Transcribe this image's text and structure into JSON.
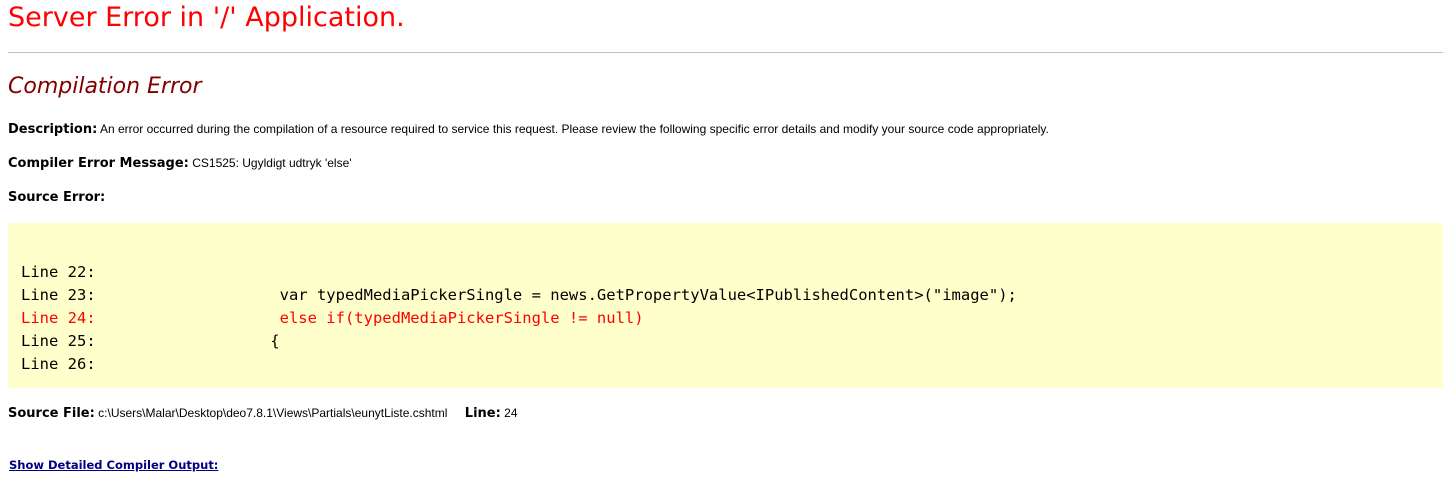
{
  "title": "Server Error in '/' Application.",
  "subtitle": "Compilation Error",
  "description": {
    "label": "Description:",
    "text": "An error occurred during the compilation of a resource required to service this request. Please review the following specific error details and modify your source code appropriately."
  },
  "compiler_message": {
    "label": "Compiler Error Message:",
    "text": "CS1525: Ugyldigt udtryk 'else'"
  },
  "source_error": {
    "label": "Source Error:",
    "lines": [
      {
        "number": "Line 22:",
        "code": "",
        "error": false
      },
      {
        "number": "Line 23:",
        "code": "                 var typedMediaPickerSingle = news.GetPropertyValue<IPublishedContent>(\"image\");",
        "error": false
      },
      {
        "number": "Line 24:",
        "code": "                 else if(typedMediaPickerSingle != null)",
        "error": true
      },
      {
        "number": "Line 25:",
        "code": "                {",
        "error": false
      },
      {
        "number": "Line 26:",
        "code": "",
        "error": false
      }
    ]
  },
  "source_file": {
    "label": "Source File:",
    "path": "c:\\Users\\Malar\\Desktop\\deo7.8.1\\Views\\Partials\\eunytListe.cshtml",
    "line_label": "Line:",
    "line_value": "24"
  },
  "detail_link": "Show Detailed Compiler Output:",
  "colors": {
    "title": "#ff0000",
    "subtitle": "#800000",
    "code_background": "#ffffcc",
    "error_line": "#ff0000",
    "link": "#000080"
  }
}
